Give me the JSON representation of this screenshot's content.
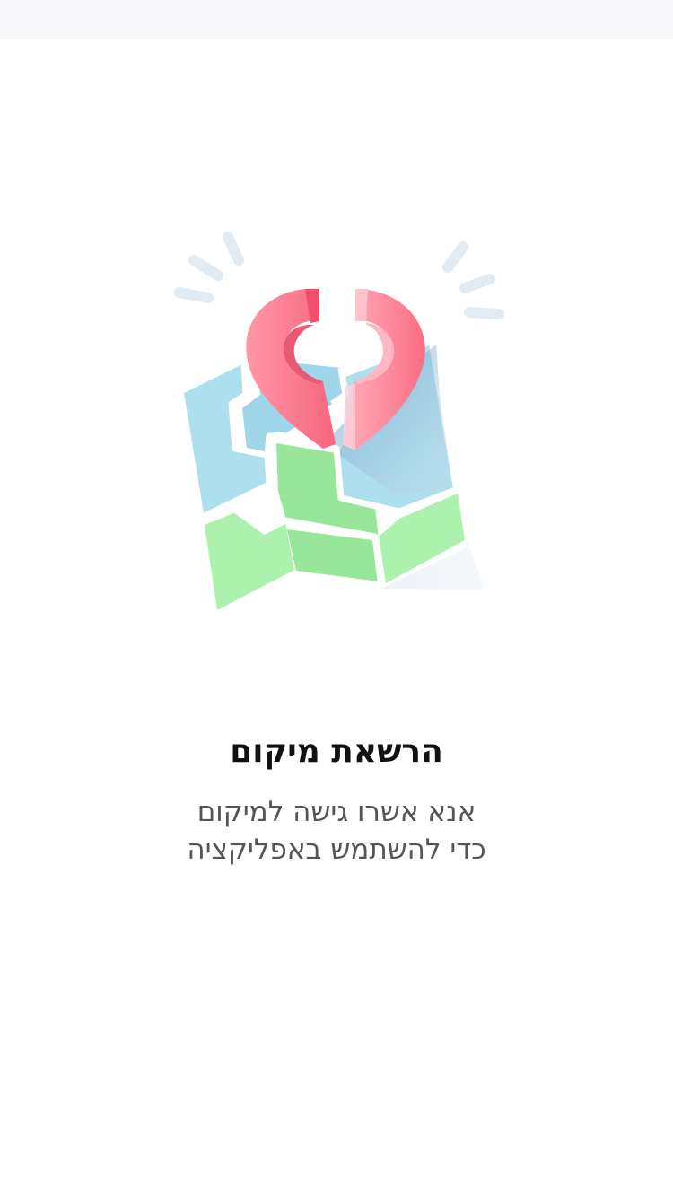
{
  "permission": {
    "title": "הרשאת מיקום",
    "message_line1": "אנא אשרו גישה למיקום",
    "message_line2": "כדי להשתמש באפליקציה"
  },
  "illustration": {
    "icon": "map-location-pin-icon",
    "colors": {
      "pin": "#ff7a8e",
      "water": "#aedfee",
      "land": "#a6eea8",
      "rays": "#e3ebf2"
    }
  }
}
